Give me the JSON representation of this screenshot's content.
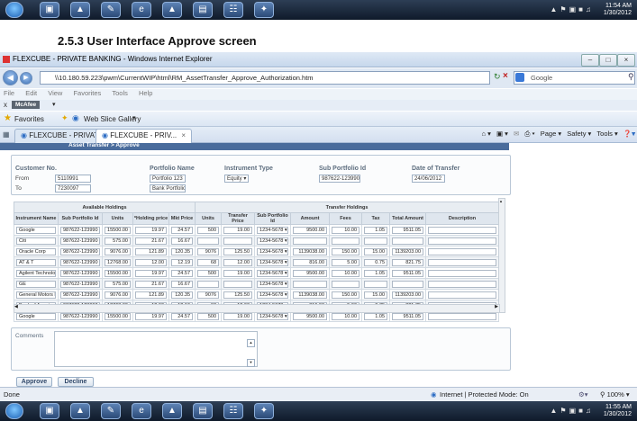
{
  "taskbar": {
    "time": "11:54 AM",
    "date": "1/30/2012",
    "bottom_time": "11:55 AM",
    "bottom_date": "1/30/2012"
  },
  "document": {
    "heading": "2.5.3 User Interface Approve screen"
  },
  "browser": {
    "window_title": "FLEXCUBE - PRIVATE BANKING - Windows Internet Explorer",
    "address": "\\\\10.180.59.223\\pwm\\CurrentWIP\\html\\RM_AssetTransfer_Approve_Authorization.htm",
    "search_placeholder": "Google",
    "menu": [
      "File",
      "Edit",
      "View",
      "Favorites",
      "Tools",
      "Help"
    ],
    "mcafee_label": "McAfee",
    "favorites_label": "Favorites",
    "web_slice_label": "Web Slice Gallery",
    "tabs": [
      "FLEXCUBE - PRIVAT...",
      "FLEXCUBE - PRIV..."
    ],
    "commands": [
      "Page",
      "Safety",
      "Tools"
    ],
    "status_left": "Done",
    "status_zone": "Internet | Protected Mode: On",
    "zoom": "100%"
  },
  "app": {
    "breadcrumb": "Asset Transfer > Approve",
    "header": {
      "customer_no_label": "Customer No.",
      "from_label": "From",
      "to_label": "To",
      "from_value": "5110991",
      "to_value": "7230097",
      "portfolio_name_label": "Portfolio Name",
      "portfolio_from": "Portfolio 123",
      "portfolio_to": "Bank Portfolio",
      "instrument_type_label": "Instrument Type",
      "instrument_type_value": "Equity",
      "sub_portfolio_label": "Sub Portfolio Id",
      "sub_portfolio_value": "987622-123990",
      "date_label": "Date of Transfer",
      "date_value": "24/06/2012"
    },
    "grid": {
      "group_available": "Available Holdings",
      "group_transfer": "Transfer Holdings",
      "columns": [
        "Instrument Name",
        "Sub Portfolio Id",
        "Units",
        "*Holding price",
        "Mkt Price",
        "Units",
        "Transfer Price",
        "Sub Portfolio Id",
        "Amount",
        "Fees",
        "Tax",
        "Total Amount",
        "Description"
      ],
      "rows": [
        [
          "Google",
          "987622-123990",
          "15500.00",
          "19.97",
          "24.57",
          "500",
          "19.00",
          "1234-5678",
          "9500.00",
          "10.00",
          "1.05",
          "9511.05",
          ""
        ],
        [
          "Citi",
          "987622-123990",
          "575.00",
          "21.67",
          "16.67",
          "",
          "",
          "1234-5678",
          "",
          "",
          "",
          "",
          ""
        ],
        [
          "Oracle Corp",
          "987622-123990",
          "9076.00",
          "121.89",
          "120.35",
          "9076",
          "125.50",
          "1234-5678",
          "1139038.00",
          "150.00",
          "15.00",
          "1139203.00",
          ""
        ],
        [
          "AT & T",
          "987622-123990",
          "12768.00",
          "12.00",
          "12.19",
          "68",
          "12.00",
          "1234-5678",
          "816.00",
          "5.00",
          "0.75",
          "821.75",
          ""
        ],
        [
          "Agilent Technologies",
          "987622-123990",
          "15500.00",
          "19.97",
          "24.57",
          "500",
          "19.00",
          "1234-5678",
          "9500.00",
          "10.00",
          "1.05",
          "9511.05",
          ""
        ],
        [
          "GE",
          "987622-123990",
          "575.00",
          "21.67",
          "16.67",
          "",
          "",
          "1234-5678",
          "",
          "",
          "",
          "",
          ""
        ],
        [
          "General Motors LTD",
          "987622-123990",
          "9076.00",
          "121.89",
          "120.35",
          "9076",
          "125.50",
          "1234-5678",
          "1139038.00",
          "150.00",
          "15.00",
          "1139203.00",
          ""
        ],
        [
          "Bank of America",
          "987622-123990",
          "12768.00",
          "12.00",
          "12.19",
          "68",
          "12.00",
          "1234-5678",
          "816.00",
          "5.00",
          "0.75",
          "821.75",
          ""
        ],
        [
          "Google",
          "987622-123990",
          "15500.00",
          "19.97",
          "24.57",
          "500",
          "19.00",
          "1234-5678",
          "9500.00",
          "10.00",
          "1.05",
          "9511.05",
          ""
        ]
      ]
    },
    "comments_label": "Comments",
    "approve_label": "Approve",
    "decline_label": "Decline"
  }
}
